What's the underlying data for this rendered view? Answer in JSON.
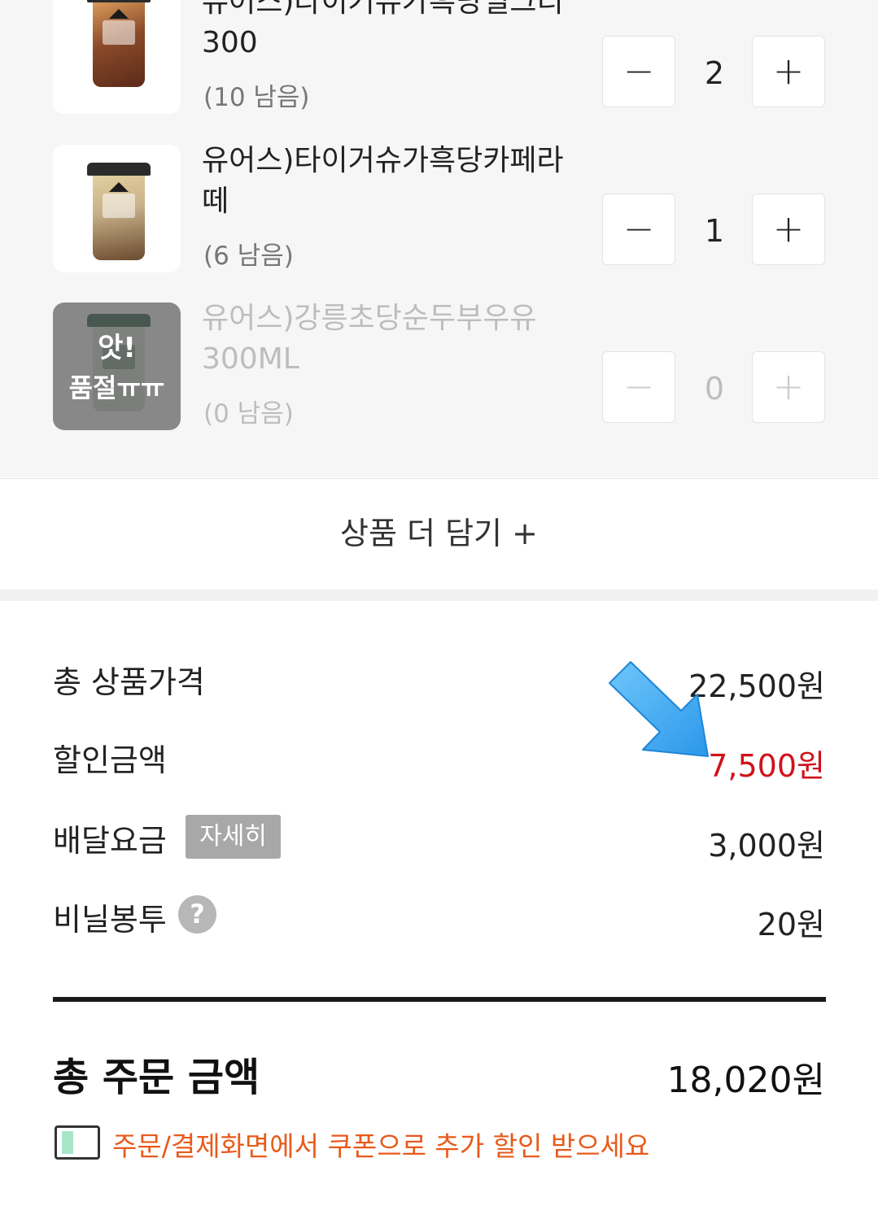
{
  "cart": {
    "items": [
      {
        "name_lines": [
          "유어스)타이거슈가흑당밀크티",
          "300"
        ],
        "stock": "(10 남음)",
        "qty": "2",
        "minus": "−",
        "plus": "+",
        "colors": {
          "cup_body": "#8a4a2a",
          "cup_accent": "#d8a070"
        }
      },
      {
        "name_lines": [
          "유어스)타이거슈가흑당카페라",
          "떼"
        ],
        "stock": "(6 남음)",
        "qty": "1",
        "minus": "−",
        "plus": "+",
        "colors": {
          "cup_body": "#c9b28a",
          "cup_accent": "#5a3a22"
        }
      },
      {
        "name_lines": [
          "유어스)강릉초당순두부우유",
          "300ML"
        ],
        "stock": "(0 남음)",
        "qty": "0",
        "minus": "−",
        "plus": "+",
        "soldout_lines": [
          "앗!",
          "품절ㅠㅠ"
        ],
        "colors": {
          "cup_body": "#dfe6dc",
          "cup_accent": "#1f4f3a"
        }
      }
    ],
    "add_more_label": "상품 더 담기 +"
  },
  "summary": {
    "rows": [
      {
        "label": "총 상품가격",
        "value": "22,500원"
      },
      {
        "label": "할인금액",
        "value": "7,500원",
        "color": "#d0121b"
      },
      {
        "label": "배달요금",
        "value": "3,000원",
        "badge": "자세히"
      },
      {
        "label": "비닐봉투",
        "value": "20원",
        "help": "?"
      }
    ],
    "total_label": "총 주문 금액",
    "total_value": "18,020원",
    "coupon_notice": "주문/결제화면에서 쿠폰으로 추가 할인 받으세요",
    "coupon_icon": "coupon-ticket-icon",
    "annotation_icon": "blue-pointer-arrow-icon",
    "colors": {
      "accent_orange": "#e85a1b",
      "discount_red": "#d0121b",
      "arrow_blue": "#3aa8f0"
    }
  }
}
